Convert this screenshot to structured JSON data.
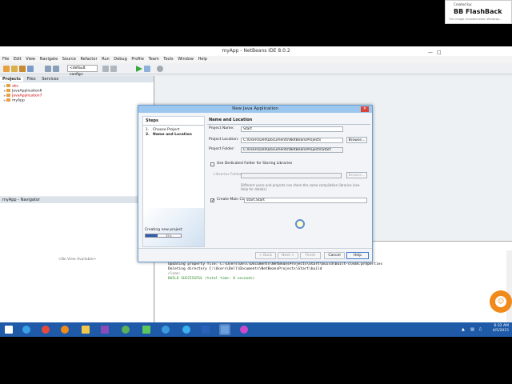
{
  "window": {
    "title": "myApp - NetBeans IDE 8.0.2"
  },
  "menu": [
    "File",
    "Edit",
    "View",
    "Navigate",
    "Source",
    "Refactor",
    "Run",
    "Debug",
    "Profile",
    "Team",
    "Tools",
    "Window",
    "Help"
  ],
  "toolbar": {
    "config_value": "<default config>"
  },
  "badge": {
    "small": "Created by:",
    "title": "BB FlashBack",
    "sub": "This image recorded when Windows..."
  },
  "projects_panel": {
    "tabs": [
      "Projects",
      "Files",
      "Services"
    ],
    "items": [
      {
        "label": "abc",
        "red": true
      },
      {
        "label": "JavaApplication6",
        "red": false
      },
      {
        "label": "JavaApplication7",
        "red": true
      },
      {
        "label": "myApp",
        "red": false
      }
    ]
  },
  "navigator": {
    "title": "myApp - Navigator",
    "empty": "<No View Available>"
  },
  "output": {
    "lines": [
      {
        "text": "Updating property file: C:\\Users\\Dell\\Documents\\NetBeansProjects\\Start\\build\\built-clean.properties",
        "style": ""
      },
      {
        "text": "Deleting directory C:\\Users\\Dell\\Documents\\NetBeansProjects\\Start\\build",
        "style": ""
      },
      {
        "text": "clean:",
        "style": "faint"
      },
      {
        "text": "BUILD SUCCESSFUL (total time: 0 seconds)",
        "style": "green"
      }
    ]
  },
  "dialog": {
    "title": "New Java Application",
    "steps_title": "Steps",
    "steps": [
      {
        "num": "1.",
        "label": "Choose Project",
        "bold": false
      },
      {
        "num": "2.",
        "label": "Name and Location",
        "bold": true
      }
    ],
    "progress_label": "Creating new project",
    "progress_pct": "35%",
    "progress_value": 0.35,
    "section_title": "Name and Location",
    "project_name_label": "Project Name:",
    "project_name_value": "Start",
    "project_location_label": "Project Location:",
    "project_location_value": "C:\\Users\\Dell\\Documents\\NetBeansProjects",
    "project_folder_label": "Project Folder:",
    "project_folder_value": "C:\\Users\\Dell\\Documents\\NetBeansProjects\\Start",
    "browse_label": "Browse...",
    "dedicated_folder_label": "Use Dedicated Folder for Storing Libraries",
    "libraries_folder_label": "Libraries Folder:",
    "libraries_note": "Different users and projects can share the same compilation libraries (see Help for details).",
    "create_main_label": "Create Main Class",
    "create_main_value": "start.Start",
    "buttons": {
      "back": "< Back",
      "next": "Next >",
      "finish": "Finish",
      "cancel": "Cancel",
      "help": "Help"
    }
  },
  "taskbar": {
    "time": "6:32 AM",
    "date": "4/5/2015"
  }
}
